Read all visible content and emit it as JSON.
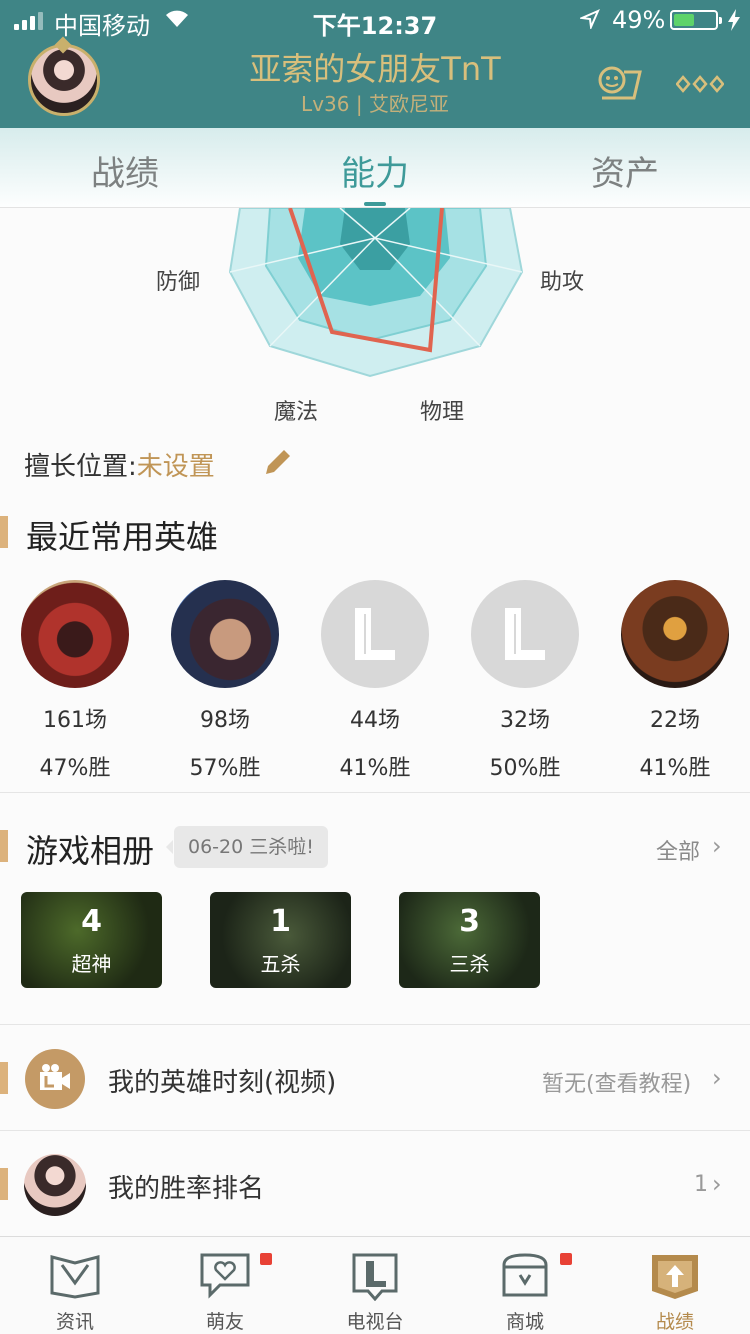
{
  "status_bar": {
    "carrier": "中国移动",
    "time": "下午12:37",
    "battery": "49%",
    "battery_level": 0.49
  },
  "profile": {
    "name": "亚索的女朋友TnT",
    "level": "Lv36",
    "server": "艾欧尼亚"
  },
  "tabs": [
    {
      "label": "战绩"
    },
    {
      "label": "能力",
      "active": true
    },
    {
      "label": "资产"
    }
  ],
  "radar": {
    "labels": [
      "防御",
      "助攻",
      "魔法",
      "物理"
    ]
  },
  "position": {
    "label": "擅长位置:",
    "value": "未设置"
  },
  "heroes_section": {
    "title": "最近常用英雄",
    "heroes": [
      {
        "games": "161场",
        "winrate": "47%胜",
        "icon": "zed-portrait"
      },
      {
        "games": "98场",
        "winrate": "57%胜",
        "icon": "yasuo-portrait"
      },
      {
        "games": "44场",
        "winrate": "41%胜",
        "icon": "default-L-icon"
      },
      {
        "games": "32场",
        "winrate": "50%胜",
        "icon": "default-L-icon"
      },
      {
        "games": "22场",
        "winrate": "41%胜",
        "icon": "armored-portrait"
      }
    ]
  },
  "album_section": {
    "title": "游戏相册",
    "bubble": "06-20 三杀啦!",
    "more": "全部",
    "items": [
      {
        "count": "4",
        "label": "超神"
      },
      {
        "count": "1",
        "label": "五杀"
      },
      {
        "count": "3",
        "label": "三杀"
      }
    ]
  },
  "moments": {
    "title": "我的英雄时刻(视频)",
    "right": "暂无(查看教程)"
  },
  "ranking": {
    "title": "我的胜率排名",
    "right": "1"
  },
  "bottom_nav": [
    {
      "label": "资讯"
    },
    {
      "label": "萌友",
      "badge": true
    },
    {
      "label": "电视台"
    },
    {
      "label": "商城",
      "badge": true
    },
    {
      "label": "战绩",
      "active": true
    }
  ],
  "colors": {
    "header": "#3f8586",
    "accent": "#3e9a99",
    "gold": "#c09556",
    "radar_line": "#e0644f"
  }
}
